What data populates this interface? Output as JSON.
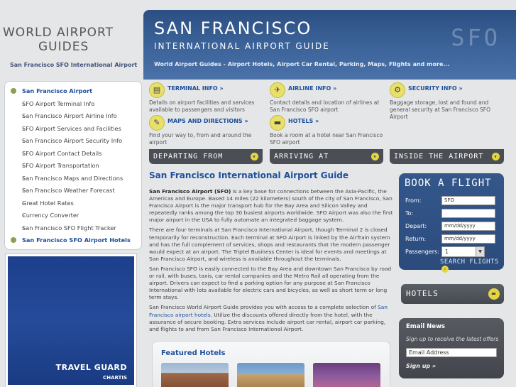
{
  "logo": {
    "line1": "WORLD AIRPORT",
    "line2": "GUIDES",
    "subtitle": "San Francisco SFO International Airport"
  },
  "banner": {
    "title": "SAN FRANCISCO",
    "subtitle": "INTERNATIONAL AIRPORT GUIDE",
    "tagline": "World Airport Guides - Airport Hotels, Airport Car Rental, Parking, Maps, Flights and more...",
    "decor": "SFO"
  },
  "sidebar": {
    "items": [
      {
        "label": "San Francisco Airport",
        "type": "main"
      },
      {
        "label": "SFO Airport Terminal Info",
        "type": "sub"
      },
      {
        "label": "San Francisco Airport Airline Info",
        "type": "sub"
      },
      {
        "label": "SFO Airport Services and Facilities",
        "type": "sub"
      },
      {
        "label": "San Francisco Airport Security Info",
        "type": "sub"
      },
      {
        "label": "SFO Airport Contact Details",
        "type": "sub"
      },
      {
        "label": "SFO Airport Transportation",
        "type": "sub"
      },
      {
        "label": "San Francisco Maps and Directions",
        "type": "sub"
      },
      {
        "label": "San Francisco Weather Forecast",
        "type": "sub"
      },
      {
        "label": "Great Hotel Rates",
        "type": "sub"
      },
      {
        "label": "Currency Converter",
        "type": "sub"
      },
      {
        "label": "San Francisco SFO Flight Tracker",
        "type": "sub"
      },
      {
        "label": "San Francisco SFO Airport Hotels",
        "type": "main"
      }
    ]
  },
  "ad": {
    "brand": "TRAVEL GUARD",
    "sub": "CHARTIS"
  },
  "info": {
    "terminal": {
      "title": "TERMINAL INFO »",
      "text": "Details on airport facilities and services available to passengers and visitors",
      "icon": "terminal-icon"
    },
    "airline": {
      "title": "AIRLINE INFO »",
      "text": "Contact details and location of airlines at San Francisco SFO airport",
      "icon": "airplane-icon"
    },
    "security": {
      "title": "SECURITY INFO »",
      "text": "Baggage storage, lost and found and general security at San Francisco SFO Airport",
      "icon": "security-icon"
    },
    "maps": {
      "title": "MAPS AND DIRECTIONS »",
      "text": "Find your way to, from and around the airport",
      "icon": "compass-icon"
    },
    "hotels": {
      "title": "HOTELS »",
      "text": "Book a room at a hotel near San Francisco SFO airport",
      "icon": "bed-icon"
    }
  },
  "bars": {
    "departing": "DEPARTING FROM",
    "arriving": "ARRIVING AT",
    "inside": "INSIDE THE AIRPORT"
  },
  "content": {
    "heading": "San Francisco International Airport Guide",
    "p1_bold": "San Francisco Airport (SFO)",
    "p1": " is a key base for connections between the Asia-Pacific, the Americas and Europe. Based 14 miles (22 kilometers) south of the city of San Francisco, San Francisco Airport is the major transport hub for the Bay Area and Silicon Valley and repeatedly ranks among the top 30 busiest airports worldwide. SFO Airport was also the first major airport in the USA to fully automate an integrated baggage system.",
    "p2": "There are four terminals at San Francisco International Airport, though Terminal 2 is closed temporarily for reconstruction. Each terminal at SFO Airport is linked by the AirTrain system and has the full complement of services, shops and restaurants that the modern passenger would expect at an airport. The Triptel Business Center is ideal for events and meetings at San Francisco Airport, and wireless is available throughout the terminals.",
    "p3": "San Francisco SFO is easily connected to the Bay Area and downtown San Francisco by road or rail, with buses, taxis, car rental companies and the Metro Rail all operating from the airport. Drivers can expect to find a parking option for any purpose at San Francisco International with lots available for electric cars and bicycles, as well as short term or long term stays.",
    "p4a": "San Francisco World Airport Guide provides you with access to a complete selection of ",
    "p4_link": "San Francisco airport hotels",
    "p4b": ". Utilize the discounts offered directly from the hotel, with the assurance of secure booking. Extra services include airport car rental, airport car parking, and flights to and from San Francisco International Airport."
  },
  "featured": {
    "title": "Featured Hotels"
  },
  "book": {
    "title": "BOOK A FLIGHT",
    "from_label": "From:",
    "from_value": "SFO",
    "to_label": "To:",
    "to_value": "",
    "depart_label": "Depart:",
    "depart_value": "mm/dd/yyyy",
    "return_label": "Return:",
    "return_value": "mm/dd/yyyy",
    "passengers_label": "Passengers:",
    "passengers_value": "1",
    "search": "SEARCH FLIGHTS"
  },
  "hotels_box": {
    "label": "HOTELS"
  },
  "email": {
    "title": "Email News",
    "sub": "Sign up to receive the latest offers",
    "placeholder": "Email Address",
    "signup": "Sign up »"
  }
}
